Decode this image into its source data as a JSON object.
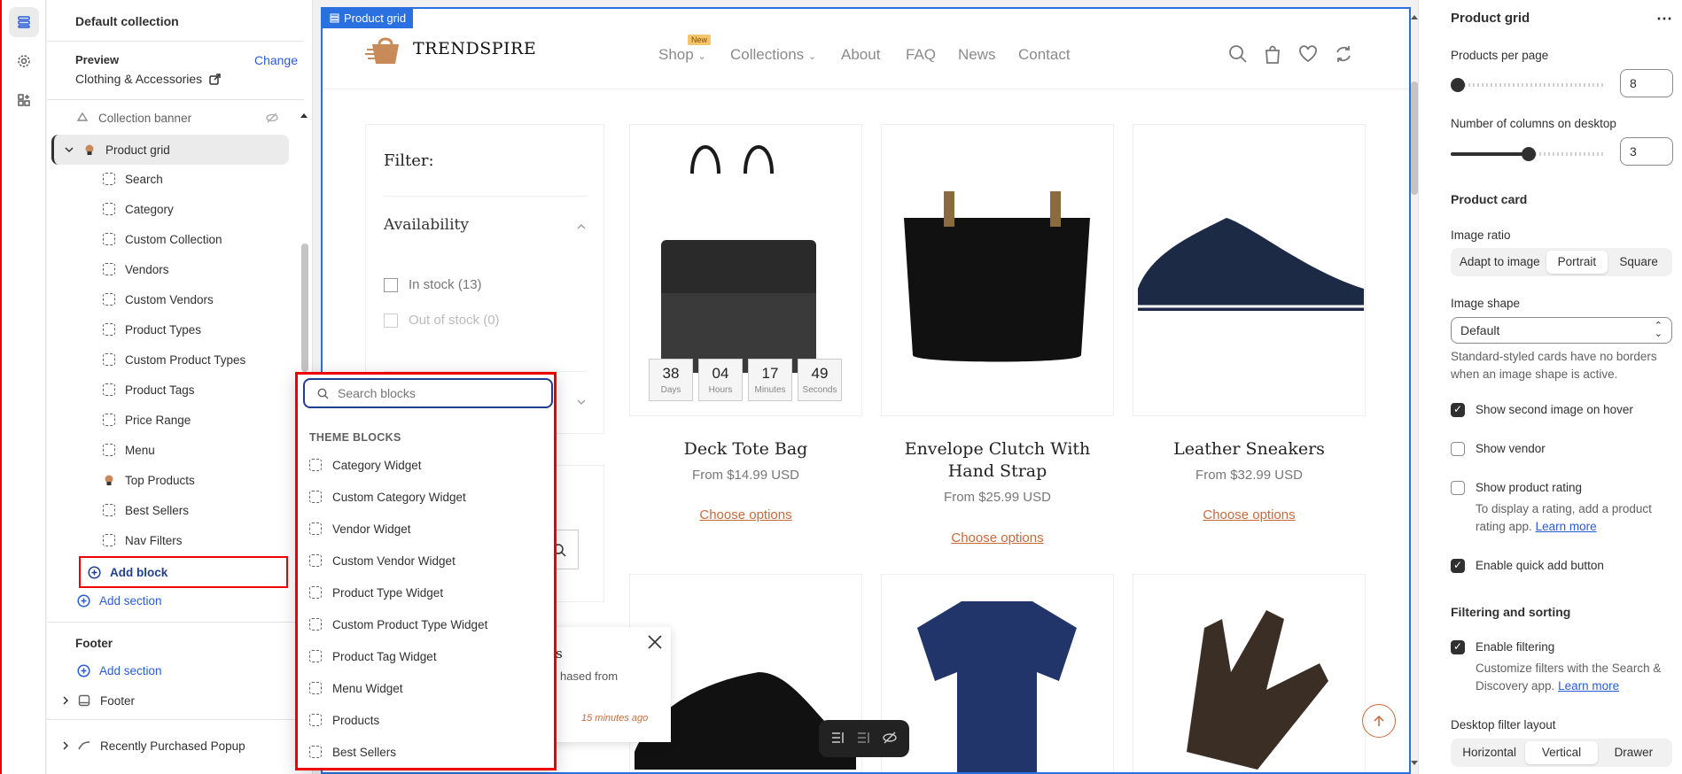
{
  "sidebar": {
    "title": "Default collection",
    "preview_label": "Preview",
    "change_label": "Change",
    "preview_value": "Clothing & Accessories",
    "section_banner": "Collection banner",
    "section_grid": "Product grid",
    "blocks": [
      "Search",
      "Category",
      "Custom Collection",
      "Vendors",
      "Custom Vendors",
      "Product Types",
      "Custom Product Types",
      "Product Tags",
      "Price Range",
      "Menu",
      "Top Products",
      "Best Sellers",
      "Nav Filters"
    ],
    "add_block": "Add block",
    "add_section": "Add section",
    "footer_group": "Footer",
    "footer_add_section": "Add section",
    "footer_item": "Footer",
    "recent_popup": "Recently Purchased Popup"
  },
  "preview": {
    "tag": "Product grid",
    "logo": "TRENDSPIRE",
    "nav": [
      "Shop",
      "Collections",
      "About",
      "FAQ",
      "News",
      "Contact"
    ],
    "new_badge": "New",
    "filter_title": "Filter:",
    "availability": "Availability",
    "in_stock": "In stock (13)",
    "out_stock": "Out of stock (0)",
    "timer": [
      {
        "n": "38",
        "l": "Days"
      },
      {
        "n": "04",
        "l": "Hours"
      },
      {
        "n": "17",
        "l": "Minutes"
      },
      {
        "n": "49",
        "l": "Seconds"
      }
    ],
    "products": [
      {
        "title": "Deck Tote Bag",
        "price": "From $14.99 USD",
        "cta": "Choose options"
      },
      {
        "title": "Envelope Clutch With Hand Strap",
        "price": "From $25.99 USD",
        "cta": "Choose options"
      },
      {
        "title": "Leather Sneakers",
        "price": "From $32.99 USD",
        "cta": "Choose options"
      }
    ],
    "toast_title_frag": "s",
    "toast_body_frag": "hased from",
    "toast_time": "15 minutes ago"
  },
  "popover": {
    "placeholder": "Search blocks",
    "heading": "THEME BLOCKS",
    "items": [
      "Category Widget",
      "Custom Category Widget",
      "Vendor Widget",
      "Custom Vendor Widget",
      "Product Type Widget",
      "Custom Product Type Widget",
      "Product Tag Widget",
      "Menu Widget",
      "Products",
      "Best Sellers"
    ]
  },
  "right": {
    "title": "Product grid",
    "products_per_page_label": "Products per page",
    "products_per_page": "8",
    "columns_label": "Number of columns on desktop",
    "columns": "3",
    "card_heading": "Product card",
    "image_ratio_label": "Image ratio",
    "image_ratio_options": [
      "Adapt to image",
      "Portrait",
      "Square"
    ],
    "image_ratio_selected": "Portrait",
    "image_shape_label": "Image shape",
    "image_shape_value": "Default",
    "image_shape_help": "Standard-styled cards have no borders when an image shape is active.",
    "show_second_image": "Show second image on hover",
    "show_vendor": "Show vendor",
    "show_rating": "Show product rating",
    "rating_help": "To display a rating, add a product rating app.",
    "learn_more": "Learn more",
    "quick_add": "Enable quick add button",
    "filter_heading": "Filtering and sorting",
    "enable_filtering": "Enable filtering",
    "filter_help": "Customize filters with the Search & Discovery app.",
    "learn_more2": "Learn more",
    "desktop_filter_label": "Desktop filter layout",
    "filter_layout_options": [
      "Horizontal",
      "Vertical",
      "Drawer"
    ],
    "filter_layout_selected": "Vertical"
  }
}
